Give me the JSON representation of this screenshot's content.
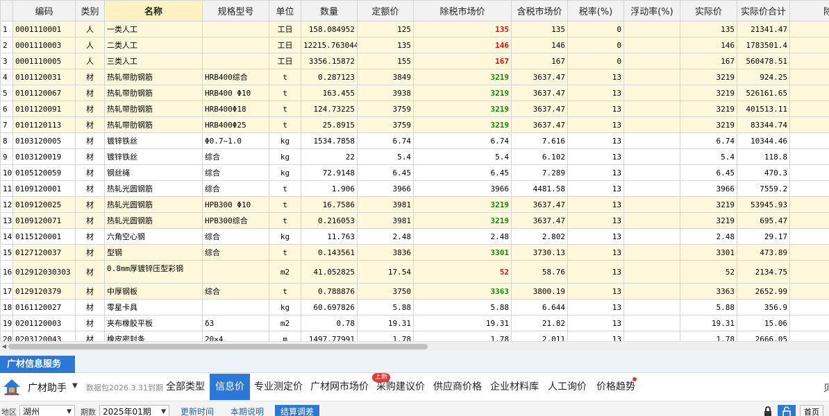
{
  "columns": [
    "",
    "编码",
    "类别",
    "名称",
    "规格型号",
    "单位",
    "数量",
    "定额价",
    "除税市场价",
    "含税市场价",
    "税率(%)",
    "浮动率(%)",
    "实际价",
    "实际价合计",
    "除税"
  ],
  "rows": [
    {
      "idx": "1",
      "code": "0001110001",
      "cat": "人",
      "name": "一类人工",
      "spec": "",
      "unit": "工日",
      "qty": "158.084952",
      "quota": "125",
      "mkt": "135",
      "mkt_style": "red",
      "tax": "135",
      "rate": "0",
      "float": "",
      "real": "135",
      "total": "21341.47",
      "bg": "y"
    },
    {
      "idx": "2",
      "code": "0001110003",
      "cat": "人",
      "name": "二类人工",
      "spec": "",
      "unit": "工日",
      "qty": "12215.763044",
      "quota": "135",
      "mkt": "146",
      "mkt_style": "red",
      "tax": "146",
      "rate": "0",
      "float": "",
      "real": "146",
      "total": "1783501.4",
      "bg": "y"
    },
    {
      "idx": "3",
      "code": "0001110005",
      "cat": "人",
      "name": "三类人工",
      "spec": "",
      "unit": "工日",
      "qty": "3356.15872",
      "quota": "155",
      "mkt": "167",
      "mkt_style": "red",
      "tax": "167",
      "rate": "0",
      "float": "",
      "real": "167",
      "total": "560478.51",
      "bg": "y"
    },
    {
      "idx": "4",
      "code": "0101120031",
      "cat": "材",
      "name": "热轧带肋钢筋",
      "spec": "HRB400综合",
      "unit": "t",
      "qty": "0.287123",
      "quota": "3849",
      "mkt": "3219",
      "mkt_style": "green",
      "tax": "3637.47",
      "rate": "13",
      "float": "",
      "real": "3219",
      "total": "924.25",
      "bg": "y"
    },
    {
      "idx": "5",
      "code": "0101120067",
      "cat": "材",
      "name": "热轧带肋钢筋",
      "spec": "HRB400 Φ10",
      "unit": "t",
      "qty": "163.455",
      "quota": "3938",
      "mkt": "3219",
      "mkt_style": "green",
      "tax": "3637.47",
      "rate": "13",
      "float": "",
      "real": "3219",
      "total": "526161.65",
      "bg": "y"
    },
    {
      "idx": "6",
      "code": "0101120091",
      "cat": "材",
      "name": "热轧带肋钢筋",
      "spec": "HRB400Φ18",
      "unit": "t",
      "qty": "124.73225",
      "quota": "3759",
      "mkt": "3219",
      "mkt_style": "green",
      "tax": "3637.47",
      "rate": "13",
      "float": "",
      "real": "3219",
      "total": "401513.11",
      "bg": "y"
    },
    {
      "idx": "7",
      "code": "0101120113",
      "cat": "材",
      "name": "热轧带肋钢筋",
      "spec": "HRB400Φ25",
      "unit": "t",
      "qty": "25.8915",
      "quota": "3759",
      "mkt": "3219",
      "mkt_style": "green",
      "tax": "3637.47",
      "rate": "13",
      "float": "",
      "real": "3219",
      "total": "83344.74",
      "bg": "y"
    },
    {
      "idx": "8",
      "code": "0103120005",
      "cat": "材",
      "name": "镀锌铁丝",
      "spec": "Φ0.7~1.0",
      "unit": "kg",
      "qty": "1534.7858",
      "quota": "6.74",
      "mkt": "6.74",
      "mkt_style": "",
      "tax": "7.616",
      "rate": "13",
      "float": "",
      "real": "6.74",
      "total": "10344.46",
      "bg": "w"
    },
    {
      "idx": "9",
      "code": "0103120019",
      "cat": "材",
      "name": "镀锌铁丝",
      "spec": "综合",
      "unit": "kg",
      "qty": "22",
      "quota": "5.4",
      "mkt": "5.4",
      "mkt_style": "",
      "tax": "6.102",
      "rate": "13",
      "float": "",
      "real": "5.4",
      "total": "118.8",
      "bg": "w"
    },
    {
      "idx": "10",
      "code": "0105120059",
      "cat": "材",
      "name": "钢丝绳",
      "spec": "综合",
      "unit": "kg",
      "qty": "72.9148",
      "quota": "6.45",
      "mkt": "6.45",
      "mkt_style": "",
      "tax": "7.289",
      "rate": "13",
      "float": "",
      "real": "6.45",
      "total": "470.3",
      "bg": "w"
    },
    {
      "idx": "11",
      "code": "0109120001",
      "cat": "材",
      "name": "热轧光圆钢筋",
      "spec": "综合",
      "unit": "t",
      "qty": "1.906",
      "quota": "3966",
      "mkt": "3966",
      "mkt_style": "",
      "tax": "4481.58",
      "rate": "13",
      "float": "",
      "real": "3966",
      "total": "7559.2",
      "bg": "w"
    },
    {
      "idx": "12",
      "code": "0109120025",
      "cat": "材",
      "name": "热轧光圆钢筋",
      "spec": "HPB300 Φ10",
      "unit": "t",
      "qty": "16.7586",
      "quota": "3981",
      "mkt": "3219",
      "mkt_style": "green",
      "tax": "3637.47",
      "rate": "13",
      "float": "",
      "real": "3219",
      "total": "53945.93",
      "bg": "y"
    },
    {
      "idx": "13",
      "code": "0109120071",
      "cat": "材",
      "name": "热轧光圆钢筋",
      "spec": "HPB300综合",
      "unit": "t",
      "qty": "0.216053",
      "quota": "3981",
      "mkt": "3219",
      "mkt_style": "green",
      "tax": "3637.47",
      "rate": "13",
      "float": "",
      "real": "3219",
      "total": "695.47",
      "bg": "y"
    },
    {
      "idx": "14",
      "code": "0115120001",
      "cat": "材",
      "name": "六角空心钢",
      "spec": "综合",
      "unit": "kg",
      "qty": "11.763",
      "quota": "2.48",
      "mkt": "2.48",
      "mkt_style": "",
      "tax": "2.802",
      "rate": "13",
      "float": "",
      "real": "2.48",
      "total": "29.17",
      "bg": "w"
    },
    {
      "idx": "15",
      "code": "0127120037",
      "cat": "材",
      "name": "型钢",
      "spec": "综合",
      "unit": "t",
      "qty": "0.143561",
      "quota": "3836",
      "mkt": "3301",
      "mkt_style": "green",
      "tax": "3730.13",
      "rate": "13",
      "float": "",
      "real": "3301",
      "total": "473.89",
      "bg": "y"
    },
    {
      "idx": "16",
      "code": "012912030303",
      "cat": "材",
      "name": "0.8mm厚镀锌压型彩钢",
      "spec": "",
      "unit": "m2",
      "qty": "41.052825",
      "quota": "17.54",
      "mkt": "52",
      "mkt_style": "red",
      "tax": "58.76",
      "rate": "13",
      "float": "",
      "real": "52",
      "total": "2134.75",
      "bg": "y",
      "tall": true
    },
    {
      "idx": "17",
      "code": "0129120379",
      "cat": "材",
      "name": "中厚钢板",
      "spec": "综合",
      "unit": "t",
      "qty": "0.788876",
      "quota": "3750",
      "mkt": "3363",
      "mkt_style": "green",
      "tax": "3800.19",
      "rate": "13",
      "float": "",
      "real": "3363",
      "total": "2652.99",
      "bg": "y"
    },
    {
      "idx": "18",
      "code": "0161120027",
      "cat": "材",
      "name": "零星卡具",
      "spec": "",
      "unit": "kg",
      "qty": "60.697826",
      "quota": "5.88",
      "mkt": "5.88",
      "mkt_style": "",
      "tax": "6.644",
      "rate": "13",
      "float": "",
      "real": "5.88",
      "total": "356.9",
      "bg": "w"
    },
    {
      "idx": "19",
      "code": "0201120003",
      "cat": "材",
      "name": "夹布橡胶平板",
      "spec": "δ3",
      "unit": "m2",
      "qty": "0.78",
      "quota": "19.31",
      "mkt": "19.31",
      "mkt_style": "",
      "tax": "21.82",
      "rate": "13",
      "float": "",
      "real": "19.31",
      "total": "15.06",
      "bg": "w"
    },
    {
      "idx": "20",
      "code": "0203120043",
      "cat": "材",
      "name": "橡皮密封条",
      "spec": "20×4",
      "unit": "m",
      "qty": "1497.77991",
      "quota": "1.78",
      "mkt": "1.78",
      "mkt_style": "",
      "tax": "2.011",
      "rate": "13",
      "float": "",
      "real": "1.78",
      "total": "2666.05",
      "bg": "w"
    }
  ],
  "panel": {
    "tab_label": "广材信息服务",
    "brand": "广材助手",
    "package_note": "数据包2026.3.31到期",
    "tabs": [
      "全部类型",
      "信息价",
      "专业测定价",
      "广材网市场价",
      "采购建议价",
      "供应商价格",
      "企业材料库",
      "人工询价",
      "价格趋势"
    ],
    "active_tab": "信息价",
    "badge": "上新",
    "right_label": "贝",
    "filters": {
      "region_label": "地区",
      "region_value": "湖州",
      "period_label": "期数",
      "period_value": "2025年01期",
      "btn_update": "更新时间",
      "btn_desc": "本期说明",
      "btn_calc": "结算调差",
      "home": "首页"
    }
  },
  "colors": {
    "accent": "#2b78d6",
    "red_price": "#e01010",
    "green_price": "#0a8a0a",
    "row_yellow": "#fdf8dc"
  }
}
